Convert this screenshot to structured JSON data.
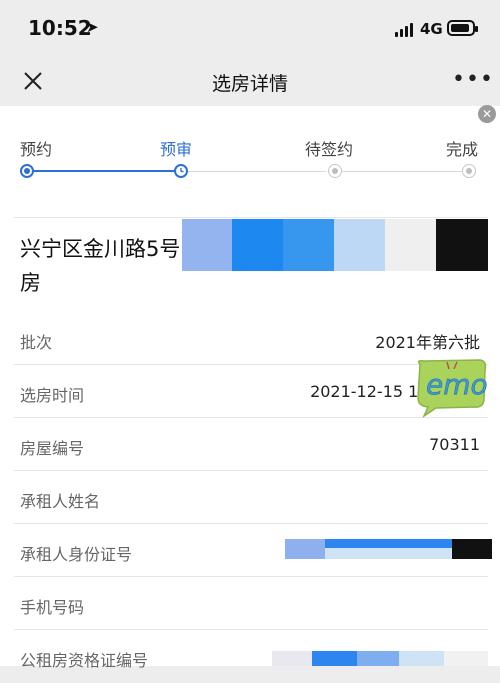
{
  "status_bar": {
    "time": "10:52",
    "network": "4G"
  },
  "nav": {
    "title": "选房详情"
  },
  "steps": [
    {
      "label": "预约",
      "state": "done"
    },
    {
      "label": "预审",
      "state": "active"
    },
    {
      "label": "待签约",
      "state": "pending"
    },
    {
      "label": "完成",
      "state": "pending"
    }
  ],
  "house": {
    "address": "兴宁区金川路5号房"
  },
  "details": [
    {
      "label": "批次",
      "value": "2021年第六批"
    },
    {
      "label": "选房时间",
      "value": "2021-12-15 12:21:02"
    },
    {
      "label": "房屋编号",
      "value": "70311"
    },
    {
      "label": "承租人姓名",
      "value": ""
    },
    {
      "label": "承租人身份证号",
      "value": ""
    },
    {
      "label": "手机号码",
      "value": ""
    },
    {
      "label": "公租房资格证编号",
      "value": ""
    }
  ],
  "sticker": {
    "text": "emo"
  },
  "colors": {
    "accent": "#2d6fd8",
    "background": "#ededed"
  }
}
